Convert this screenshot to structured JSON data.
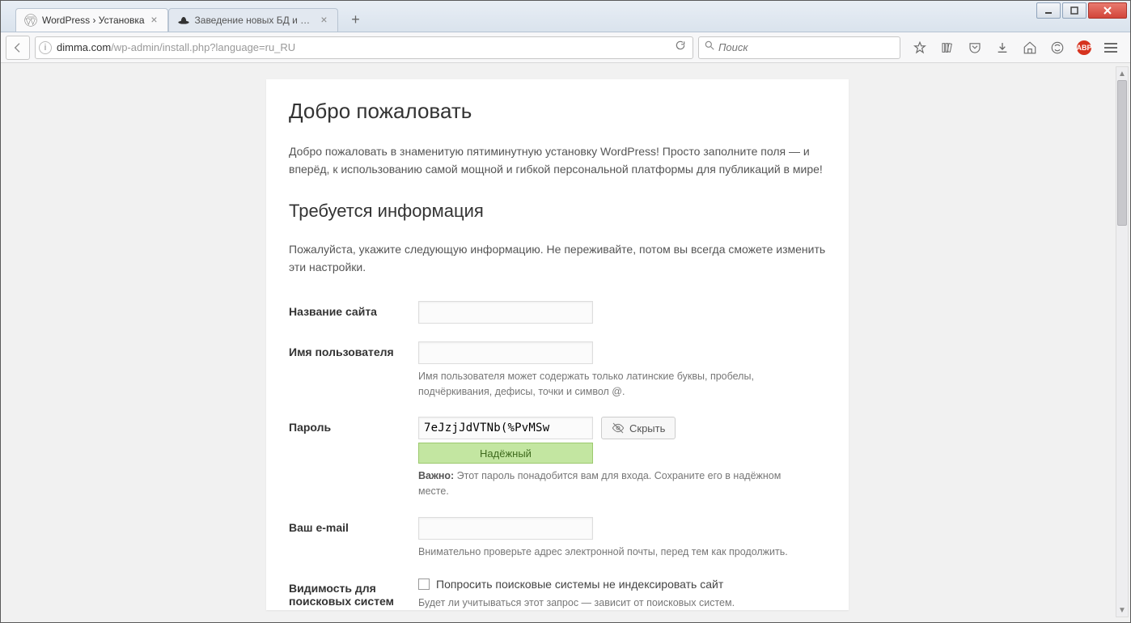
{
  "browser": {
    "tabs": [
      {
        "title": "WordPress › Установка",
        "active": true
      },
      {
        "title": "Заведение новых БД и по...",
        "active": false
      }
    ],
    "url_host": "dimma.com",
    "url_path": "/wp-admin/install.php?language=ru_RU",
    "search_placeholder": "Поиск"
  },
  "page": {
    "h1": "Добро пожаловать",
    "intro": "Добро пожаловать в знаменитую пятиминутную установку WordPress! Просто заполните поля — и вперёд, к использованию самой мощной и гибкой персональной платформы для публикаций в мире!",
    "h2": "Требуется информация",
    "sub": "Пожалуйста, укажите следующую информацию. Не переживайте, потом вы всегда сможете изменить эти настройки.",
    "fields": {
      "site_title": {
        "label": "Название сайта",
        "value": ""
      },
      "username": {
        "label": "Имя пользователя",
        "value": "",
        "hint": "Имя пользователя может содержать только латинские буквы, пробелы, подчёркивания, дефисы, точки и символ @."
      },
      "password": {
        "label": "Пароль",
        "value": "7eJzjJdVTNb(%PvMSw",
        "hide_button": "Скрыть",
        "strength": "Надёжный",
        "note_strong": "Важно:",
        "note": " Этот пароль понадобится вам для входа. Сохраните его в надёжном месте."
      },
      "email": {
        "label": "Ваш e-mail",
        "value": "",
        "hint": "Внимательно проверьте адрес электронной почты, перед тем как продолжить."
      },
      "visibility": {
        "label_line1": "Видимость для",
        "label_line2": "поисковых систем",
        "checkbox_label": "Попросить поисковые системы не индексировать сайт",
        "hint": "Будет ли учитываться этот запрос — зависит от поисковых систем."
      }
    }
  }
}
